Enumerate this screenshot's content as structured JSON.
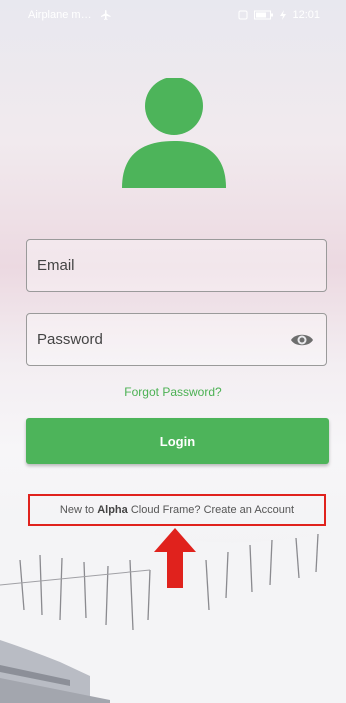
{
  "status_bar": {
    "carrier": "Airplane m…",
    "airplane_icon": "airplane-icon",
    "time": "12:01"
  },
  "login": {
    "avatar_icon": "user-avatar-icon",
    "email_placeholder": "Email",
    "password_placeholder": "Password",
    "show_password_icon": "eye-icon",
    "forgot_password": "Forgot Password?",
    "login_button": "Login"
  },
  "signup": {
    "prefix": "New to ",
    "brand": "Alpha",
    "suffix": " Cloud Frame? Create an Account"
  },
  "colors": {
    "accent": "#4db45a",
    "link": "#4bb153",
    "highlight": "#e0221d"
  }
}
